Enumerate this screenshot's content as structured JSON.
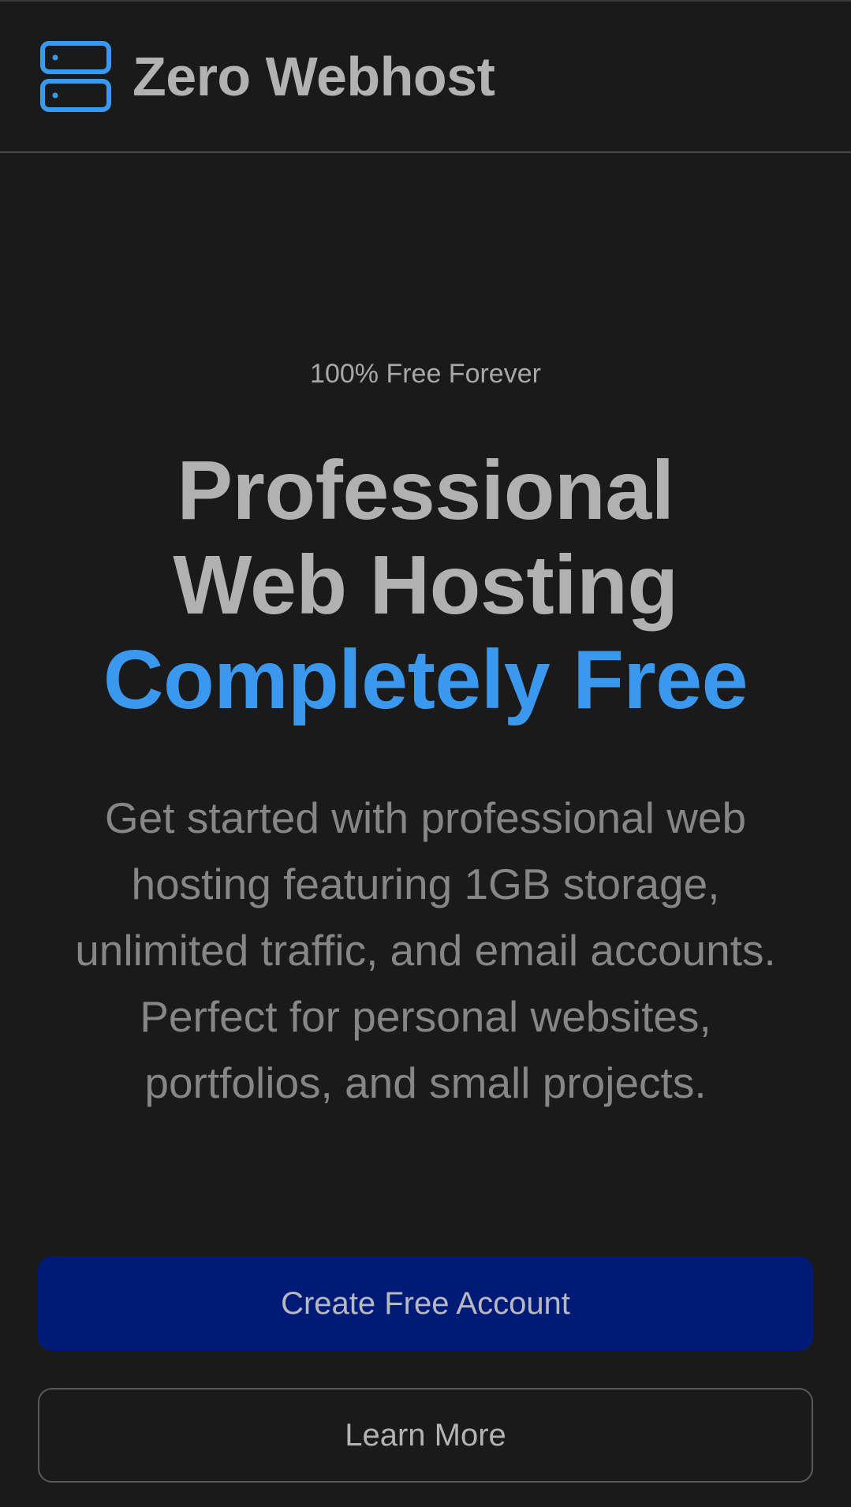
{
  "header": {
    "brand_name": "Zero Webhost",
    "logo_icon": "server-icon",
    "accent_color": "#3a99ef"
  },
  "hero": {
    "eyebrow": "100% Free Forever",
    "headline_line1": "Professional",
    "headline_line2": "Web Hosting",
    "headline_highlight": "Completely Free",
    "description": "Get started with professional web hosting featuring 1GB storage, unlimited traffic, and email accounts. Perfect for personal websites, portfolios, and small projects."
  },
  "actions": {
    "primary_label": "Create Free Account",
    "secondary_label": "Learn More",
    "primary_color": "#001a78"
  }
}
